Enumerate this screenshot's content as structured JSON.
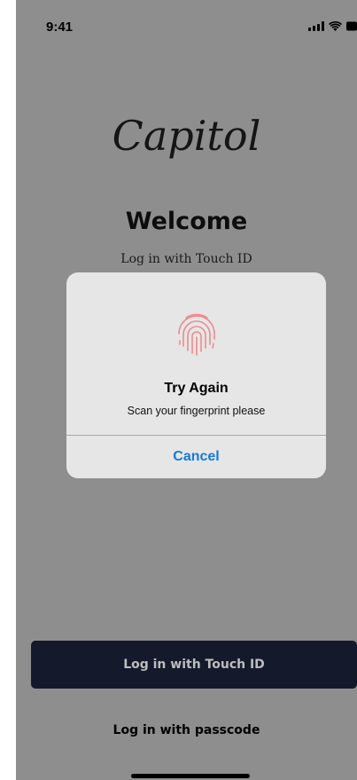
{
  "status_bar": {
    "time": "9:41",
    "signal_icon": "cellular-signal-icon",
    "wifi_icon": "wifi-icon",
    "battery_icon": "battery-icon"
  },
  "brand": {
    "logo_text": "Capitol"
  },
  "main": {
    "title": "Welcome",
    "subtitle": "Log in with Touch ID"
  },
  "dialog": {
    "icon": "fingerprint-icon",
    "icon_color": "#f08a8f",
    "title": "Try Again",
    "message": "Scan your fingerprint please",
    "cancel_label": "Cancel",
    "cancel_color": "#1a78d8"
  },
  "actions": {
    "touch_id_label": "Log in with Touch ID",
    "passcode_label": "Log in with passcode"
  },
  "colors": {
    "overlay": "#8e8e8e",
    "primary_button": "#141a2c"
  }
}
